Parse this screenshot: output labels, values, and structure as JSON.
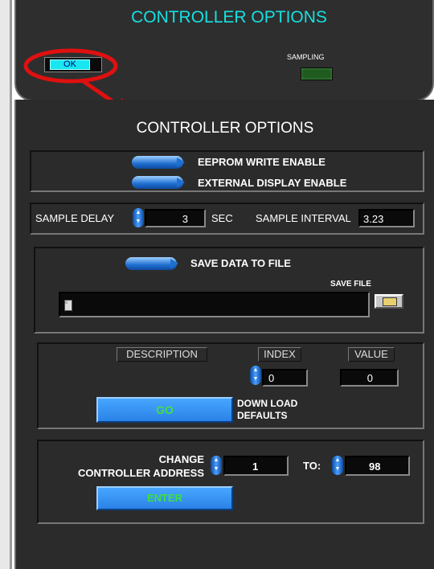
{
  "top_panel": {
    "title": "CONTROLLER OPTIONS",
    "ok_label": "OK",
    "sampling_label": "SAMPLING"
  },
  "main": {
    "title": "CONTROLLER OPTIONS",
    "toggles": {
      "eeprom_label": "EEPROM WRITE ENABLE",
      "external_display_label": "EXTERNAL DISPLAY ENABLE"
    },
    "sample": {
      "delay_label": "SAMPLE DELAY",
      "delay_value": "3",
      "unit": "SEC",
      "interval_label": "SAMPLE INTERVAL",
      "interval_value": "3.23"
    },
    "save": {
      "toggle_label": "SAVE DATA TO FILE",
      "file_label": "SAVE FILE",
      "path_value": ""
    },
    "defaults": {
      "description_header": "DESCRIPTION",
      "index_header": "INDEX",
      "value_header": "VALUE",
      "index_value": "0",
      "value_value": "0",
      "go_label": "GO",
      "download_label_1": "DOWN LOAD",
      "download_label_2": "DEFAULTS"
    },
    "address": {
      "change_label_1": "CHANGE",
      "change_label_2": "CONTROLLER ADDRESS",
      "current_value": "1",
      "to_label": "TO:",
      "new_value": "98",
      "enter_label": "ENTER"
    }
  },
  "colors": {
    "accent_cyan": "#16e0e0",
    "button_blue": "#2a82e6",
    "button_text_green": "#3fe03f",
    "annotation_red": "#e01010",
    "led_green": "#1f5a1f"
  }
}
